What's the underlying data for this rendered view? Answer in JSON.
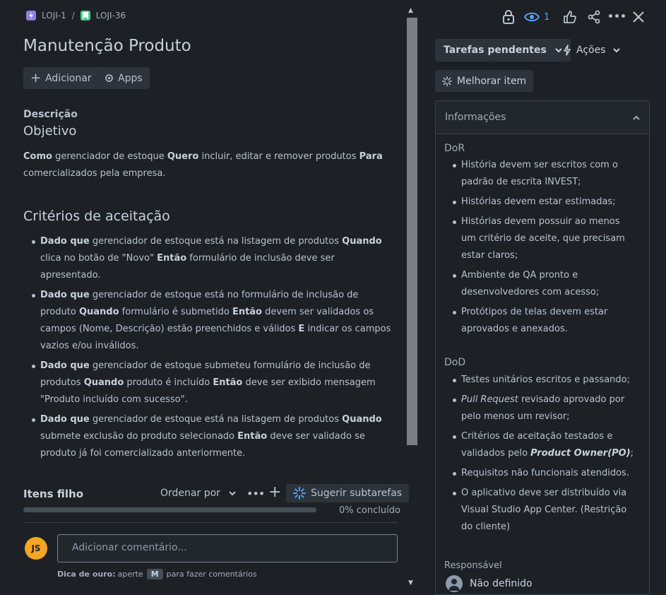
{
  "breadcrumb": {
    "parent": "LOJI-1",
    "separator": "/",
    "current": "LOJI-36"
  },
  "issue": {
    "title": "Manutenção Produto"
  },
  "toolbar": {
    "add_label": "Adicionar",
    "apps_label": "Apps"
  },
  "description": {
    "label": "Descrição",
    "objective_heading": "Objetivo",
    "objective": [
      {
        "b": "Como"
      },
      {
        "t": " gerenciador de estoque "
      },
      {
        "b": "Quero"
      },
      {
        "t": " incluir, editar e remover produtos "
      },
      {
        "b": "Para"
      },
      {
        "t": " comercializados pela empresa."
      }
    ],
    "criteria_heading": "Critérios de aceitação",
    "criteria": [
      [
        {
          "b": "Dado que"
        },
        {
          "t": " gerenciador de estoque está na listagem de produtos "
        },
        {
          "b": "Quando"
        },
        {
          "t": " clica no botão de \"Novo\" "
        },
        {
          "b": "Então"
        },
        {
          "t": " formulário de inclusão deve ser apresentado."
        }
      ],
      [
        {
          "b": "Dado que"
        },
        {
          "t": " gerenciador de estoque está no formulário de inclusão de produto "
        },
        {
          "b": "Quando"
        },
        {
          "t": " formulário é submetido "
        },
        {
          "b": "Então"
        },
        {
          "t": " devem ser validados os campos (Nome, Descrição) estão preenchidos e válidos "
        },
        {
          "b": "E"
        },
        {
          "t": " indicar os campos vazios e/ou inválidos."
        }
      ],
      [
        {
          "b": "Dado que"
        },
        {
          "t": " gerenciador de estoque submeteu formulário de inclusão de produtos "
        },
        {
          "b": "Quando"
        },
        {
          "t": " produto é incluído "
        },
        {
          "b": "Então"
        },
        {
          "t": " deve ser exibido mensagem \"Produto incluído com sucesso\"."
        }
      ],
      [
        {
          "b": "Dado que"
        },
        {
          "t": " gerenciador de estoque está na listagem de produtos "
        },
        {
          "b": "Quando"
        },
        {
          "t": " submete exclusão do produto selecionado "
        },
        {
          "b": "Então"
        },
        {
          "t": " deve ser validado se produto já foi comercializado anteriormente."
        }
      ]
    ]
  },
  "child_items": {
    "label": "Itens filho",
    "sort_label": "Ordenar por",
    "suggest_label": "Sugerir subtarefas",
    "progress_text": "0% concluído",
    "progress": 0
  },
  "comment": {
    "avatar": "JS",
    "placeholder": "Adicionar comentário...",
    "tip_label": "Dica de ouro:",
    "tip_pre": "aperte",
    "tip_key": "M",
    "tip_post": "para fazer comentários"
  },
  "header_actions": {
    "watch_count": "1"
  },
  "sidebar": {
    "status_label": "Tarefas pendentes",
    "actions_label": "Ações",
    "improve_label": "Melhorar item",
    "info_label": "Informações",
    "dor_label": "DoR",
    "dor_items": [
      [
        {
          "t": "História devem ser escritos com o padrão de escrita INVEST;"
        }
      ],
      [
        {
          "t": "Histórias devem estar estimadas;"
        }
      ],
      [
        {
          "t": "Histórias devem possuir ao menos um critério de aceite, que precisam estar claros;"
        }
      ],
      [
        {
          "t": "Ambiente de QA pronto e desenvolvedores com acesso;"
        }
      ],
      [
        {
          "t": "Protótipos de telas devem estar aprovados e anexados."
        }
      ]
    ],
    "dod_label": "DoD",
    "dod_items": [
      [
        {
          "t": "Testes unitários escritos e passando;"
        }
      ],
      [
        {
          "i": "Pull Request"
        },
        {
          "t": " revisado aprovado por pelo menos um revisor;"
        }
      ],
      [
        {
          "t": "Critérios de aceitação testados e validados pelo "
        },
        {
          "bi": "Product Owner(PO)"
        },
        {
          "t": ";"
        }
      ],
      [
        {
          "t": "Requisitos não funcionais atendidos."
        }
      ],
      [
        {
          "t": "O aplicativo deve ser distribuído via Visual Studio App Center. (Restrição do cliente)"
        }
      ]
    ],
    "assignee_label": "Responsável",
    "assignee_value": "Não definido"
  }
}
